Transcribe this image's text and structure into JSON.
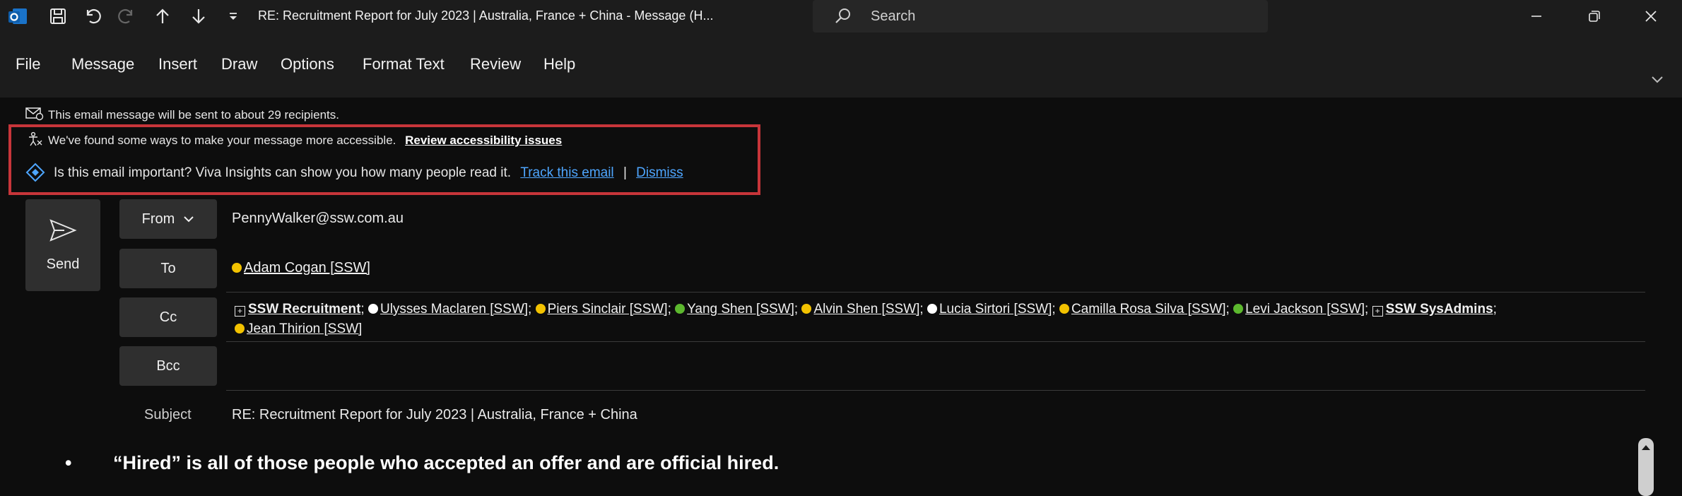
{
  "window": {
    "title": "RE: Recruitment Report for July 2023 | Australia, France + China  -  Message (H...",
    "search_label": "Search"
  },
  "menu": {
    "items": [
      "File",
      "Message",
      "Insert",
      "Draw",
      "Options",
      "Format Text",
      "Review",
      "Help"
    ]
  },
  "info": {
    "recipients_notice": "This email message will be sent to about 29 recipients.",
    "accessibility_text": "We've found some ways to make your message more accessible.",
    "accessibility_link": "Review accessibility issues",
    "viva_text": "Is this email important? Viva Insights can show you how many people read it.",
    "track_link": "Track this email",
    "separator": "|",
    "dismiss_link": "Dismiss"
  },
  "compose": {
    "send_label": "Send",
    "from_label": "From",
    "from_value": "PennyWalker@ssw.com.au",
    "to_label": "To",
    "to_recipients": [
      {
        "name": "Adam Cogan [SSW]",
        "status": "yellow"
      }
    ],
    "cc_label": "Cc",
    "cc_recipients": [
      {
        "name": "SSW Recruitment",
        "type": "group"
      },
      {
        "name": "Ulysses Maclaren [SSW]",
        "status": "white"
      },
      {
        "name": "Piers Sinclair [SSW]",
        "status": "yellow"
      },
      {
        "name": "Yang Shen [SSW]",
        "status": "green"
      },
      {
        "name": "Alvin Shen [SSW]",
        "status": "yellow"
      },
      {
        "name": "Lucia Sirtori [SSW]",
        "status": "white"
      },
      {
        "name": "Camilla Rosa Silva [SSW]",
        "status": "yellow"
      },
      {
        "name": "Levi Jackson [SSW]",
        "status": "green"
      },
      {
        "name": "SSW SysAdmins",
        "type": "group"
      },
      {
        "name": "Jean Thirion [SSW]",
        "status": "yellow"
      }
    ],
    "bcc_label": "Bcc",
    "subject_label": "Subject",
    "subject_value": "RE: Recruitment Report for July 2023 | Australia, France + China"
  },
  "body": {
    "bullet": "•",
    "bullet_text": "“Hired” is all of those people who accepted an offer and are official hired."
  },
  "colors": {
    "highlight_border": "#c7353a",
    "link": "#4ea6ff",
    "status_yellow": "#f2c200",
    "status_green": "#5cb82e"
  }
}
